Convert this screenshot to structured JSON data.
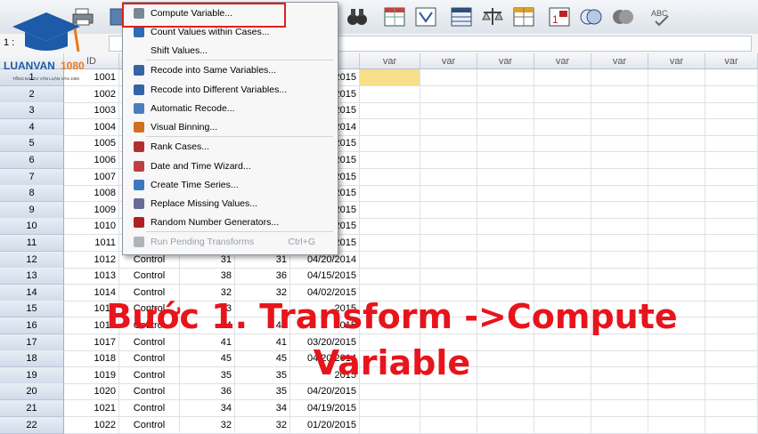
{
  "logo": {
    "brand": "LUANVAN",
    "brand_accent": "1080",
    "tagline": "TỔNG ĐÀI TƯ VẤN LUẬN VĂN 1080"
  },
  "cell_ref": "1 :",
  "columns": {
    "id": "ID",
    "var": "var"
  },
  "rows": [
    {
      "n": "1",
      "id": "1001",
      "date": "2015"
    },
    {
      "n": "2",
      "id": "1002",
      "date": "2015"
    },
    {
      "n": "3",
      "id": "1003",
      "date": "2015"
    },
    {
      "n": "4",
      "id": "1004",
      "date": "2014"
    },
    {
      "n": "5",
      "id": "1005",
      "date": "2015"
    },
    {
      "n": "6",
      "id": "1006",
      "date": "2015"
    },
    {
      "n": "7",
      "id": "1007",
      "date": "2015"
    },
    {
      "n": "8",
      "id": "1008",
      "date": "2015"
    },
    {
      "n": "9",
      "id": "1009",
      "date": "2015"
    },
    {
      "n": "10",
      "id": "1010",
      "date": "2015"
    },
    {
      "n": "11",
      "id": "1011",
      "date": "2015"
    },
    {
      "n": "12",
      "id": "1012",
      "group": "Control",
      "a": "31",
      "b": "31",
      "date": "04/20/2014"
    },
    {
      "n": "13",
      "id": "1013",
      "group": "Control",
      "a": "38",
      "b": "36",
      "date": "04/15/2015"
    },
    {
      "n": "14",
      "id": "1014",
      "group": "Control",
      "a": "32",
      "b": "32",
      "date": "04/02/2015"
    },
    {
      "n": "15",
      "id": "1015",
      "group": "Control",
      "a": "33",
      "b": "",
      "date": "2015"
    },
    {
      "n": "16",
      "id": "1016",
      "group": "Control",
      "a": "44",
      "b": "44",
      "date": "2015"
    },
    {
      "n": "17",
      "id": "1017",
      "group": "Control",
      "a": "41",
      "b": "41",
      "date": "03/20/2015"
    },
    {
      "n": "18",
      "id": "1018",
      "group": "Control",
      "a": "45",
      "b": "45",
      "date": "04/20/2014"
    },
    {
      "n": "19",
      "id": "1019",
      "group": "Control",
      "a": "35",
      "b": "35",
      "date": "2015"
    },
    {
      "n": "20",
      "id": "1020",
      "group": "Control",
      "a": "36",
      "b": "35",
      "date": "04/20/2015"
    },
    {
      "n": "21",
      "id": "1021",
      "group": "Control",
      "a": "34",
      "b": "34",
      "date": "04/19/2015"
    },
    {
      "n": "22",
      "id": "1022",
      "group": "Control",
      "a": "32",
      "b": "32",
      "date": "01/20/2015"
    }
  ],
  "menu": {
    "items": [
      {
        "label": "Compute Variable...",
        "icon": "calculator-icon"
      },
      {
        "label": "Count Values within Cases...",
        "icon": "count-icon"
      },
      {
        "label": "Shift Values...",
        "icon": ""
      },
      {
        "label": "Recode into Same Variables...",
        "icon": "recode-icon"
      },
      {
        "label": "Recode into Different Variables...",
        "icon": "recode-icon"
      },
      {
        "label": "Automatic Recode...",
        "icon": "auto-recode-icon"
      },
      {
        "label": "Visual Binning...",
        "icon": "binning-icon"
      },
      {
        "label": "Rank Cases...",
        "icon": "rank-icon"
      },
      {
        "label": "Date and Time Wizard...",
        "icon": "calendar-icon"
      },
      {
        "label": "Create Time Series...",
        "icon": "time-series-icon"
      },
      {
        "label": "Replace Missing Values...",
        "icon": "replace-icon"
      },
      {
        "label": "Random Number Generators...",
        "icon": "dice-icon"
      },
      {
        "label": "Run Pending Transforms",
        "icon": "run-icon",
        "shortcut": "Ctrl+G",
        "disabled": true
      }
    ]
  },
  "caption": {
    "line1": "Bước 1. Transform ->Compute",
    "line2": "Variable"
  },
  "colors": {
    "caption": "#e8141c",
    "highlight": "#e0201a",
    "selected_cell": "#f8e08a"
  }
}
